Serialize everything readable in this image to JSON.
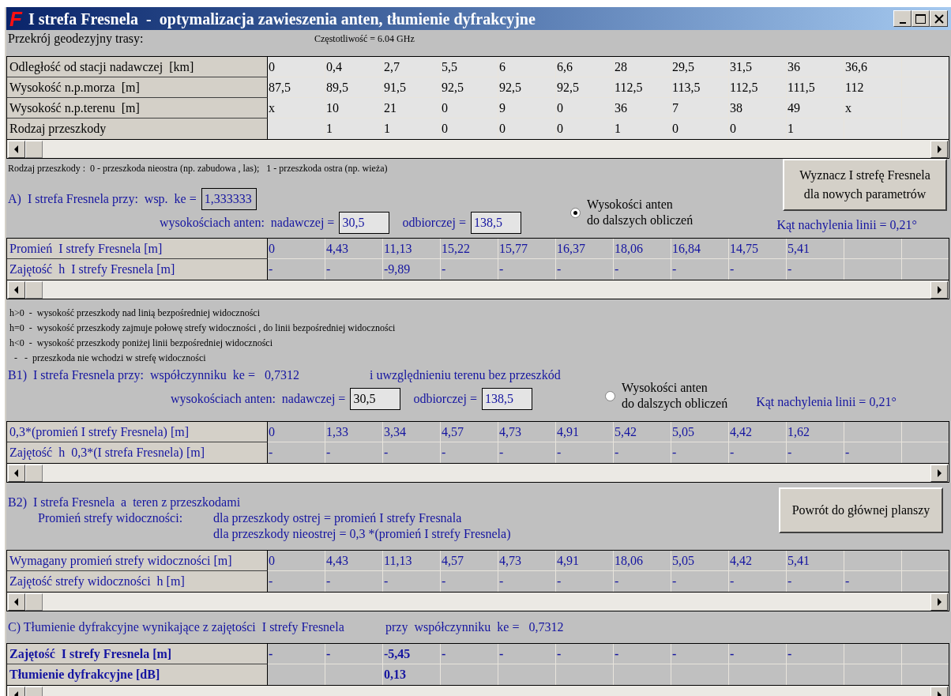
{
  "window": {
    "logo": "F",
    "title": "I strefa Fresnela  -  optymalizacja zawieszenia anten, tłumienie dyfrakcyjne"
  },
  "profile": {
    "caption": "Przekrój geodezyjny trasy:",
    "frequency": "Częstotliwość = 6.04 GHz",
    "table": {
      "kind": "input",
      "rows": [
        {
          "label": "Odległość od stacji nadawczej  [km]",
          "cells": [
            "0",
            "0,4",
            "2,7",
            "5,5",
            "6",
            "6,6",
            "28",
            "29,5",
            "31,5",
            "36",
            "36,6"
          ]
        },
        {
          "label": "Wysokość n.p.morza  [m]",
          "cells": [
            "87,5",
            "89,5",
            "91,5",
            "92,5",
            "92,5",
            "92,5",
            "112,5",
            "113,5",
            "112,5",
            "111,5",
            "112"
          ]
        },
        {
          "label": "Wysokość n.p.terenu  [m]",
          "cells": [
            "x",
            "10",
            "21",
            "0",
            "9",
            "0",
            "36",
            "7",
            "38",
            "49",
            "x"
          ]
        },
        {
          "label": "Rodzaj przeszkody",
          "cells": [
            null,
            "1",
            "1",
            "0",
            "0",
            "0",
            "1",
            "0",
            "0",
            "1"
          ]
        }
      ]
    },
    "note": "Rodzaj przeszkody :  0 - przeszkoda nieostra (np. zabudowa , las);   1 - przeszkoda ostra (np. wieża)"
  },
  "recalc_button": "Wyznacz I strefę Fresnela\ndla nowych parametrów",
  "section_a": {
    "heading": "A)  I strefa Fresnela przy:  wsp.  ke =",
    "ke_field": "1,333333",
    "heights_label": "wysokościach anten:  nadawczej =",
    "tx_field": "30,5",
    "rx_label": "odbiorczej =",
    "rx_field": "138,5",
    "radio": {
      "label": "Wysokości anten\ndo dalszych obliczeń",
      "selected": true
    },
    "angle": "Kąt nachylenia linii = 0,21°",
    "table": {
      "kind": "result",
      "rows": [
        {
          "label": "Promień  I strefy Fresnela [m]",
          "cells": [
            "0",
            "4,43",
            "11,13",
            "15,22",
            "15,77",
            "16,37",
            "18,06",
            "16,84",
            "14,75",
            "5,41"
          ]
        },
        {
          "label": "Zajętość  h  I strefy Fresnela [m]",
          "cells": [
            "-",
            "-",
            "-9,89",
            "-",
            "-",
            "-",
            "-",
            "-",
            "-",
            "-"
          ]
        }
      ]
    }
  },
  "legend": [
    "h>0  -  wysokość przeszkody nad linią bezpośredniej widoczności",
    "h=0  -  wysokość przeszkody zajmuje połowę strefy widoczności , do linii bezpośredniej widoczności",
    "h<0  -  wysokość przeszkody poniżej linii bezpośredniej widoczności",
    "  -   -  przeszkoda nie wchodzi w strefę widoczności"
  ],
  "section_b1": {
    "heading": "B1)  I strefa Fresnela przy:  współczynniku  ke =   0,7312",
    "heading_note": "i uwzględnieniu terenu bez przeszkód",
    "heights_label": "wysokościach anten:  nadawczej =",
    "tx_field": "30,5",
    "rx_label": "odbiorczej =",
    "rx_field": "138,5",
    "radio": {
      "label": "Wysokości anten\ndo dalszych obliczeń",
      "selected": false
    },
    "angle": "Kąt nachylenia linii = 0,21°",
    "table": {
      "kind": "result",
      "rows": [
        {
          "label": "0,3*(promień I strefy Fresnela) [m]",
          "cells": [
            "0",
            "1,33",
            "3,34",
            "4,57",
            "4,73",
            "4,91",
            "5,42",
            "5,05",
            "4,42",
            "1,62"
          ]
        },
        {
          "label": "Zajętość  h  0,3*(I strefa Fresnela) [m]",
          "cells": [
            "-",
            "-",
            "-",
            "-",
            "-",
            "-",
            "-",
            "-",
            "-",
            "-",
            "-"
          ]
        }
      ]
    }
  },
  "section_b2": {
    "heading": "B2)  I strefa Fresnela  a  teren z przeszkodami",
    "radius_label": "Promień strefy widoczności:",
    "rules": [
      "dla przeszkody ostrej = promień I strefy Fresnala",
      "dla przeszkody nieostrej = 0,3 *(promień I strefy Fresnela)"
    ],
    "table": {
      "kind": "result",
      "rows": [
        {
          "label": "Wymagany promień strefy widoczności [m]",
          "cells": [
            "0",
            "4,43",
            "11,13",
            "4,57",
            "4,73",
            "4,91",
            "18,06",
            "5,05",
            "4,42",
            "5,41"
          ]
        },
        {
          "label": "Zajętość strefy widoczności  h [m]",
          "cells": [
            "-",
            "-",
            "-",
            "-",
            "-",
            "-",
            "-",
            "-",
            "-",
            "-",
            "-"
          ]
        }
      ]
    }
  },
  "back_button": "Powrót do głównej planszy",
  "section_c": {
    "heading": "C) Tłumienie dyfrakcyjne wynikające z zajętości  I strefy Fresnela",
    "ke_note": "przy  współczynniku  ke =   0,7312",
    "table": {
      "kind": "bold",
      "rows": [
        {
          "label": "Zajętość  I strefy Fresnela [m]",
          "cells": [
            "-",
            "-",
            "-5,45",
            "-",
            "-",
            "-",
            "-",
            "-",
            "-",
            "-"
          ]
        },
        {
          "label": "Tłumienie dyfrakcyjne [dB]",
          "cells": [
            null,
            null,
            "0,13"
          ]
        }
      ]
    }
  }
}
